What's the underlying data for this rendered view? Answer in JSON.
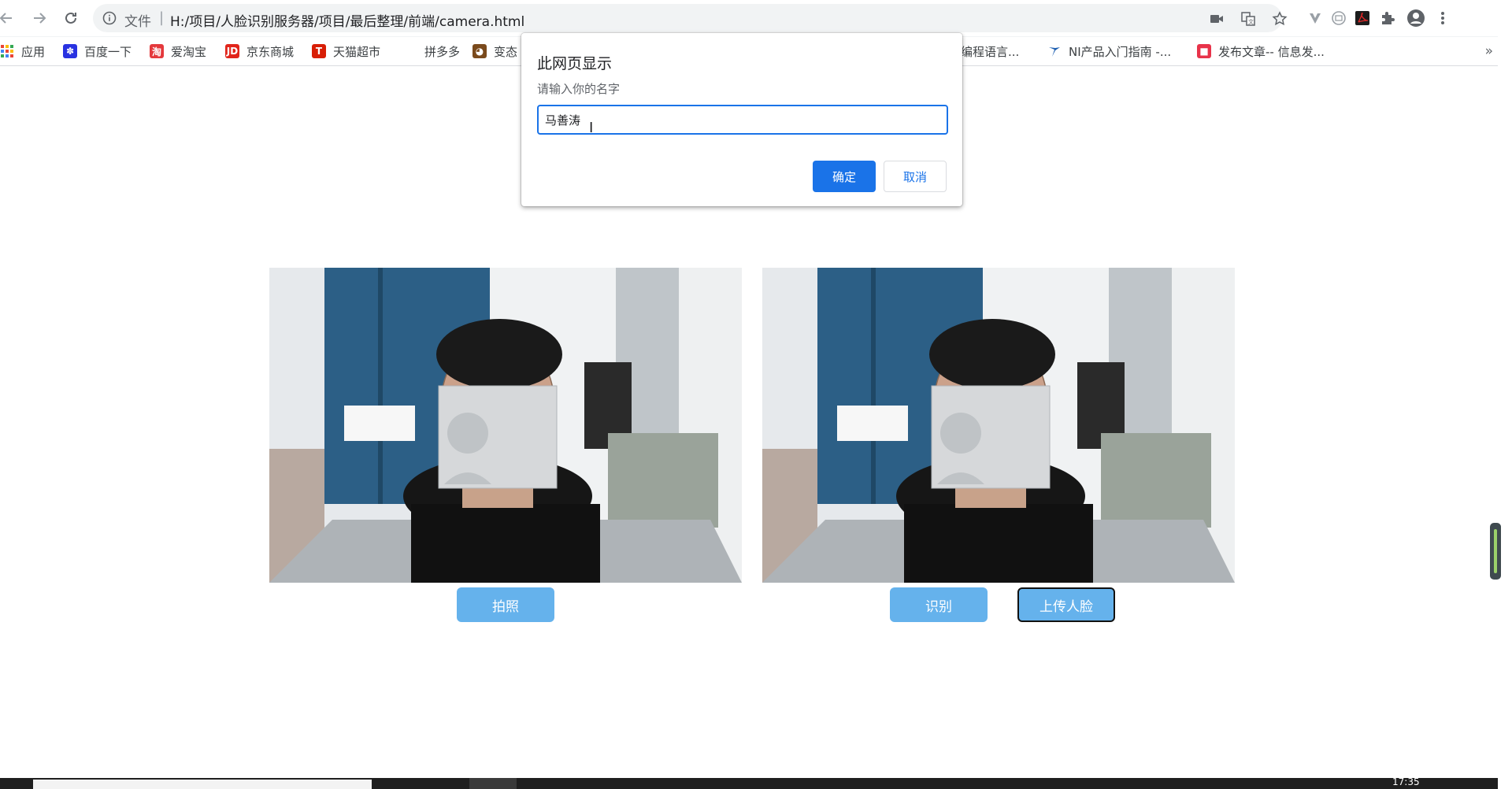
{
  "browser": {
    "omnibox": {
      "scheme_label": "文件",
      "separator": "|",
      "url": "H:/项目/人脸识别服务器/项目/最后整理/前端/camera.html"
    },
    "bookmarks": [
      {
        "label": "应用",
        "icon": "apps-grid-icon",
        "color": "#ea4335"
      },
      {
        "label": "百度一下",
        "icon": "baidu-paw-icon",
        "color": "#2932e1"
      },
      {
        "label": "爱淘宝",
        "icon": "taobao-icon",
        "color": "#e4393c"
      },
      {
        "label": "京东商城",
        "icon": "jd-icon",
        "color": "#e1251b"
      },
      {
        "label": "天猫超市",
        "icon": "tmall-icon",
        "color": "#d81e06"
      },
      {
        "label": "拼多多",
        "icon": "pinduoduo-icon",
        "color": "#e02e24"
      },
      {
        "label": "变态",
        "icon": "bookmark-site-icon",
        "color": "#7a4a1c"
      },
      {
        "label": "编程语言...",
        "icon": "bookmark-site-icon",
        "color": "#ffffff"
      },
      {
        "label": "NI产品入门指南 -...",
        "icon": "ni-icon",
        "color": "#1a5cb0"
      },
      {
        "label": "发布文章-- 信息发...",
        "icon": "publish-icon",
        "color": "#e8334a"
      }
    ],
    "more_label": "»"
  },
  "dialog": {
    "title": "此网页显示",
    "message": "请输入你的名字",
    "input_value": "马善涛",
    "ok_label": "确定",
    "cancel_label": "取消"
  },
  "page": {
    "left_button": "拍照",
    "recognize_button": "识别",
    "upload_button": "上传人脸"
  },
  "taskbar": {
    "clock": "17:35"
  },
  "colors": {
    "accent": "#1a73e8",
    "page_button": "#65b2ec"
  }
}
